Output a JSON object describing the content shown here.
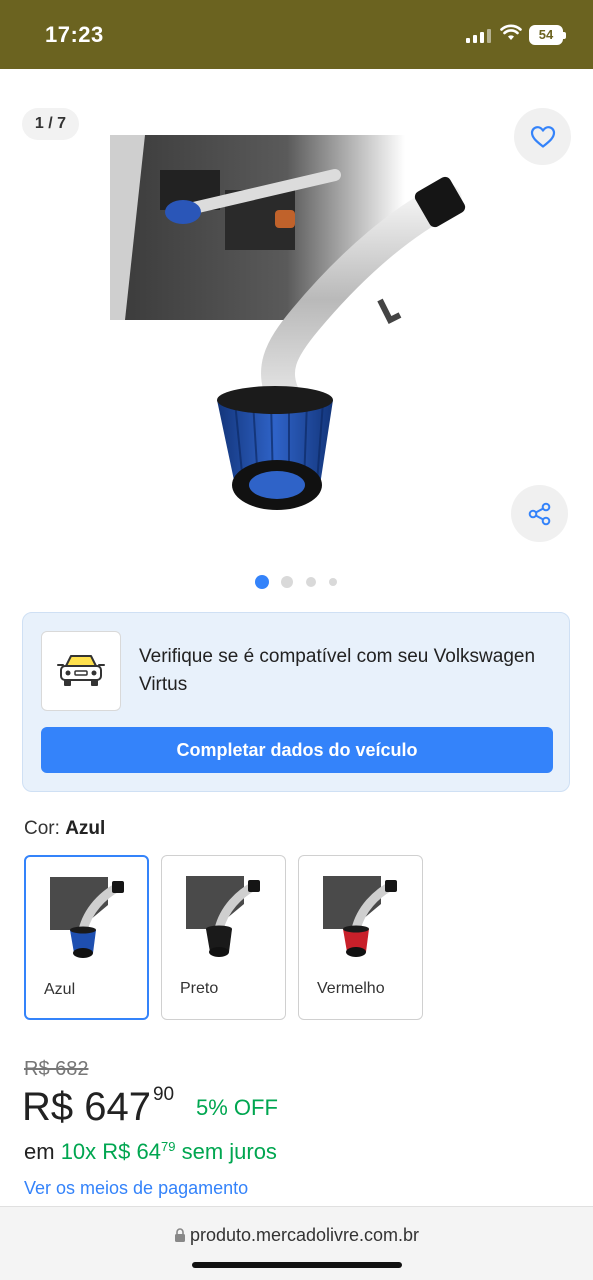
{
  "status_bar": {
    "time": "17:23",
    "battery": "54"
  },
  "gallery": {
    "counter": "1 / 7",
    "total_dots": 4,
    "active_dot": 0,
    "icons": {
      "favorite": "heart-icon",
      "share": "share-icon"
    }
  },
  "compat": {
    "text": "Verifique se é compatível com seu Volkswagen Virtus",
    "button_label": "Completar dados do veículo",
    "icon": "car-icon"
  },
  "color_selector": {
    "label": "Cor:",
    "selected": "Azul",
    "options": [
      {
        "name": "Azul",
        "filter_color": "#1e4fb0",
        "selected": true
      },
      {
        "name": "Preto",
        "filter_color": "#1a1a1a",
        "selected": false
      },
      {
        "name": "Vermelho",
        "filter_color": "#c8202a",
        "selected": false
      }
    ]
  },
  "pricing": {
    "old_price": "R$ 682",
    "price_int": "R$ 647",
    "price_cents": "90",
    "discount": "5% OFF",
    "installments_prefix": "em",
    "installments_plan": "10x R$ 64",
    "installments_cents": "79",
    "installments_suffix": "sem juros",
    "payment_link": "Ver os meios de pagamento"
  },
  "browser": {
    "url": "produto.mercadolivre.com.br",
    "icon": "lock-icon"
  },
  "colors": {
    "accent": "#3483fa",
    "green": "#00a650",
    "status_bar": "#6b6320"
  }
}
